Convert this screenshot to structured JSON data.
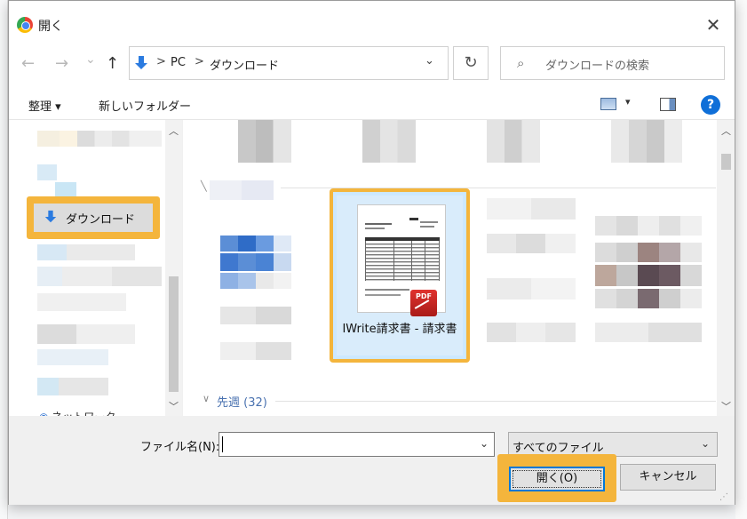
{
  "window": {
    "title": "開く",
    "close_symbol": "✕"
  },
  "nav": {
    "back_symbol": "←",
    "forward_symbol": "→",
    "recent_symbol": "⌄",
    "up_symbol": "↑"
  },
  "address": {
    "crumbs": [
      "PC",
      "ダウンロード"
    ],
    "separator": ">",
    "dropdown_symbol": "⌄",
    "refresh_symbol": "↻"
  },
  "search": {
    "placeholder": "ダウンロードの検索"
  },
  "toolbar": {
    "organize_label": "整理 ▾",
    "new_folder_label": "新しいフォルダー",
    "view_drop_symbol": "▾",
    "help_symbol": "?"
  },
  "sidebar": {
    "downloads_label": "ダウンロード",
    "network_label": "ネットワーク"
  },
  "files": {
    "selected_name": "IWrite請求書 - 請求書",
    "pdf_badge": "PDF",
    "group_last_week": "先週 (32)"
  },
  "bottom": {
    "filename_label": "ファイル名(N):",
    "filename_value": "",
    "filter_value": "すべてのファイル",
    "open_label": "開く(O)",
    "cancel_label": "キャンセル",
    "dropdown_symbol": "⌄"
  },
  "colors": {
    "highlight": "#f4b53c",
    "selection": "#cce8ff",
    "accent": "#0078d7"
  }
}
